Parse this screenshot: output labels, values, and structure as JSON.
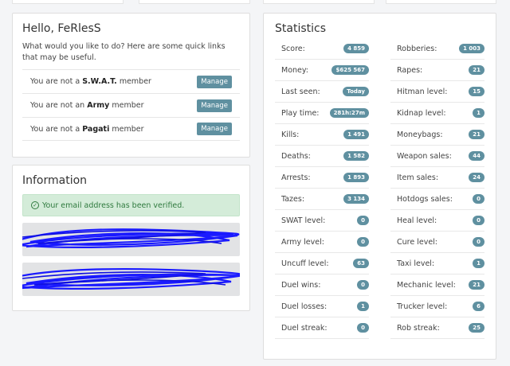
{
  "hello": {
    "title": "Hello, FeRlesS",
    "intro": "What would you like to do? Here are some quick links that may be useful.",
    "memberships": [
      {
        "prefix": "You are not a",
        "group": "S.W.A.T.",
        "suffix": "member",
        "button": "Manage"
      },
      {
        "prefix": "You are not an",
        "group": "Army",
        "suffix": "member",
        "button": "Manage"
      },
      {
        "prefix": "You are not a",
        "group": "Pagati",
        "suffix": "member",
        "button": "Manage"
      }
    ]
  },
  "info": {
    "title": "Information",
    "verified": "Your email address has been verified."
  },
  "stats": {
    "title": "Statistics",
    "left": [
      {
        "label": "Score:",
        "value": "4 859"
      },
      {
        "label": "Money:",
        "value": "$625 567"
      },
      {
        "label": "Last seen:",
        "value": "Today"
      },
      {
        "label": "Play time:",
        "value": "281h:27m"
      },
      {
        "label": "Kills:",
        "value": "1 491"
      },
      {
        "label": "Deaths:",
        "value": "1 582"
      },
      {
        "label": "Arrests:",
        "value": "1 893"
      },
      {
        "label": "Tazes:",
        "value": "3 134"
      },
      {
        "label": "SWAT level:",
        "value": "0"
      },
      {
        "label": "Army level:",
        "value": "0"
      },
      {
        "label": "Uncuff level:",
        "value": "63"
      },
      {
        "label": "Duel wins:",
        "value": "0"
      },
      {
        "label": "Duel losses:",
        "value": "1"
      },
      {
        "label": "Duel streak:",
        "value": "0"
      }
    ],
    "right": [
      {
        "label": "Robberies:",
        "value": "1 003"
      },
      {
        "label": "Rapes:",
        "value": "21"
      },
      {
        "label": "Hitman level:",
        "value": "15"
      },
      {
        "label": "Kidnap level:",
        "value": "1"
      },
      {
        "label": "Moneybags:",
        "value": "21"
      },
      {
        "label": "Weapon sales:",
        "value": "44"
      },
      {
        "label": "Item sales:",
        "value": "24"
      },
      {
        "label": "Hotdogs sales:",
        "value": "0"
      },
      {
        "label": "Heal level:",
        "value": "0"
      },
      {
        "label": "Cure level:",
        "value": "0"
      },
      {
        "label": "Taxi level:",
        "value": "1"
      },
      {
        "label": "Mechanic level:",
        "value": "21"
      },
      {
        "label": "Trucker level:",
        "value": "6"
      },
      {
        "label": "Rob streak:",
        "value": "25"
      }
    ]
  }
}
